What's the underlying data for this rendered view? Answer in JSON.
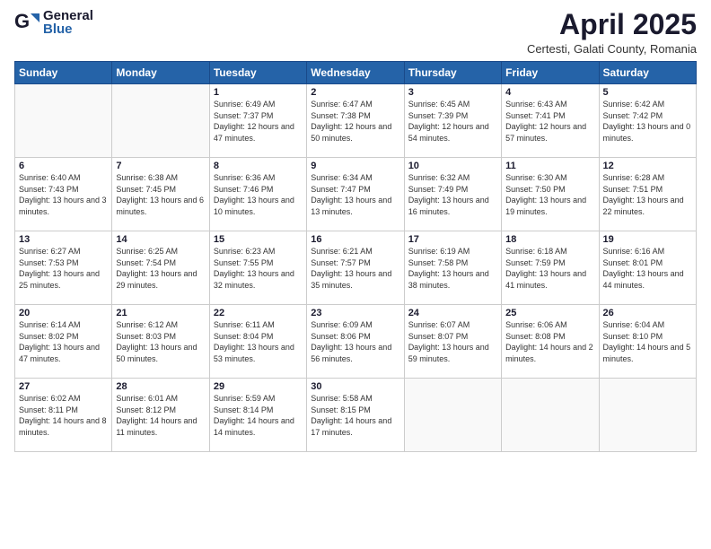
{
  "header": {
    "logo_general": "General",
    "logo_blue": "Blue",
    "month_title": "April 2025",
    "subtitle": "Certesti, Galati County, Romania"
  },
  "days_of_week": [
    "Sunday",
    "Monday",
    "Tuesday",
    "Wednesday",
    "Thursday",
    "Friday",
    "Saturday"
  ],
  "weeks": [
    [
      {
        "day": "",
        "info": ""
      },
      {
        "day": "",
        "info": ""
      },
      {
        "day": "1",
        "info": "Sunrise: 6:49 AM\nSunset: 7:37 PM\nDaylight: 12 hours and 47 minutes."
      },
      {
        "day": "2",
        "info": "Sunrise: 6:47 AM\nSunset: 7:38 PM\nDaylight: 12 hours and 50 minutes."
      },
      {
        "day": "3",
        "info": "Sunrise: 6:45 AM\nSunset: 7:39 PM\nDaylight: 12 hours and 54 minutes."
      },
      {
        "day": "4",
        "info": "Sunrise: 6:43 AM\nSunset: 7:41 PM\nDaylight: 12 hours and 57 minutes."
      },
      {
        "day": "5",
        "info": "Sunrise: 6:42 AM\nSunset: 7:42 PM\nDaylight: 13 hours and 0 minutes."
      }
    ],
    [
      {
        "day": "6",
        "info": "Sunrise: 6:40 AM\nSunset: 7:43 PM\nDaylight: 13 hours and 3 minutes."
      },
      {
        "day": "7",
        "info": "Sunrise: 6:38 AM\nSunset: 7:45 PM\nDaylight: 13 hours and 6 minutes."
      },
      {
        "day": "8",
        "info": "Sunrise: 6:36 AM\nSunset: 7:46 PM\nDaylight: 13 hours and 10 minutes."
      },
      {
        "day": "9",
        "info": "Sunrise: 6:34 AM\nSunset: 7:47 PM\nDaylight: 13 hours and 13 minutes."
      },
      {
        "day": "10",
        "info": "Sunrise: 6:32 AM\nSunset: 7:49 PM\nDaylight: 13 hours and 16 minutes."
      },
      {
        "day": "11",
        "info": "Sunrise: 6:30 AM\nSunset: 7:50 PM\nDaylight: 13 hours and 19 minutes."
      },
      {
        "day": "12",
        "info": "Sunrise: 6:28 AM\nSunset: 7:51 PM\nDaylight: 13 hours and 22 minutes."
      }
    ],
    [
      {
        "day": "13",
        "info": "Sunrise: 6:27 AM\nSunset: 7:53 PM\nDaylight: 13 hours and 25 minutes."
      },
      {
        "day": "14",
        "info": "Sunrise: 6:25 AM\nSunset: 7:54 PM\nDaylight: 13 hours and 29 minutes."
      },
      {
        "day": "15",
        "info": "Sunrise: 6:23 AM\nSunset: 7:55 PM\nDaylight: 13 hours and 32 minutes."
      },
      {
        "day": "16",
        "info": "Sunrise: 6:21 AM\nSunset: 7:57 PM\nDaylight: 13 hours and 35 minutes."
      },
      {
        "day": "17",
        "info": "Sunrise: 6:19 AM\nSunset: 7:58 PM\nDaylight: 13 hours and 38 minutes."
      },
      {
        "day": "18",
        "info": "Sunrise: 6:18 AM\nSunset: 7:59 PM\nDaylight: 13 hours and 41 minutes."
      },
      {
        "day": "19",
        "info": "Sunrise: 6:16 AM\nSunset: 8:01 PM\nDaylight: 13 hours and 44 minutes."
      }
    ],
    [
      {
        "day": "20",
        "info": "Sunrise: 6:14 AM\nSunset: 8:02 PM\nDaylight: 13 hours and 47 minutes."
      },
      {
        "day": "21",
        "info": "Sunrise: 6:12 AM\nSunset: 8:03 PM\nDaylight: 13 hours and 50 minutes."
      },
      {
        "day": "22",
        "info": "Sunrise: 6:11 AM\nSunset: 8:04 PM\nDaylight: 13 hours and 53 minutes."
      },
      {
        "day": "23",
        "info": "Sunrise: 6:09 AM\nSunset: 8:06 PM\nDaylight: 13 hours and 56 minutes."
      },
      {
        "day": "24",
        "info": "Sunrise: 6:07 AM\nSunset: 8:07 PM\nDaylight: 13 hours and 59 minutes."
      },
      {
        "day": "25",
        "info": "Sunrise: 6:06 AM\nSunset: 8:08 PM\nDaylight: 14 hours and 2 minutes."
      },
      {
        "day": "26",
        "info": "Sunrise: 6:04 AM\nSunset: 8:10 PM\nDaylight: 14 hours and 5 minutes."
      }
    ],
    [
      {
        "day": "27",
        "info": "Sunrise: 6:02 AM\nSunset: 8:11 PM\nDaylight: 14 hours and 8 minutes."
      },
      {
        "day": "28",
        "info": "Sunrise: 6:01 AM\nSunset: 8:12 PM\nDaylight: 14 hours and 11 minutes."
      },
      {
        "day": "29",
        "info": "Sunrise: 5:59 AM\nSunset: 8:14 PM\nDaylight: 14 hours and 14 minutes."
      },
      {
        "day": "30",
        "info": "Sunrise: 5:58 AM\nSunset: 8:15 PM\nDaylight: 14 hours and 17 minutes."
      },
      {
        "day": "",
        "info": ""
      },
      {
        "day": "",
        "info": ""
      },
      {
        "day": "",
        "info": ""
      }
    ]
  ]
}
